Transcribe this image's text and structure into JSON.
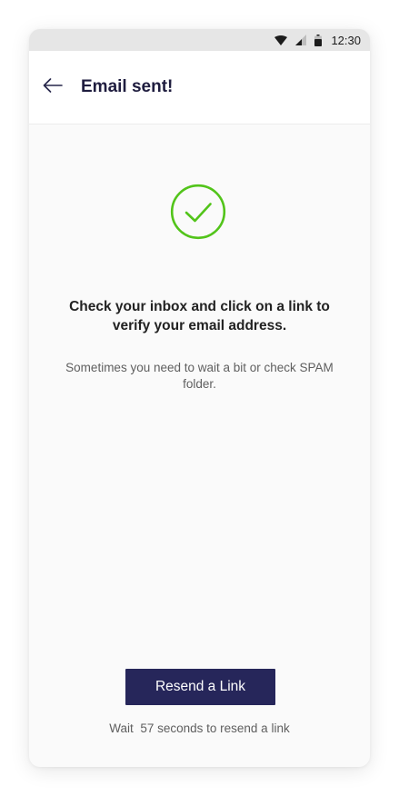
{
  "status_bar": {
    "time": "12:30",
    "icons": [
      "wifi-icon",
      "signal-icon",
      "battery-icon"
    ]
  },
  "header": {
    "back_icon": "arrow-left-icon",
    "title": "Email sent!"
  },
  "main": {
    "success_icon": "check-circle-icon",
    "headline": "Check your inbox and click on a link to verify your email address.",
    "subtext": "Sometimes you need to wait a bit or check SPAM folder."
  },
  "footer": {
    "resend_label": "Resend a Link",
    "wait_prefix": "Wait",
    "seconds": "57",
    "wait_suffix": "seconds to resend a link"
  },
  "colors": {
    "accent_green": "#52c41a",
    "button_bg": "#26265a",
    "title": "#1f1d3f"
  }
}
